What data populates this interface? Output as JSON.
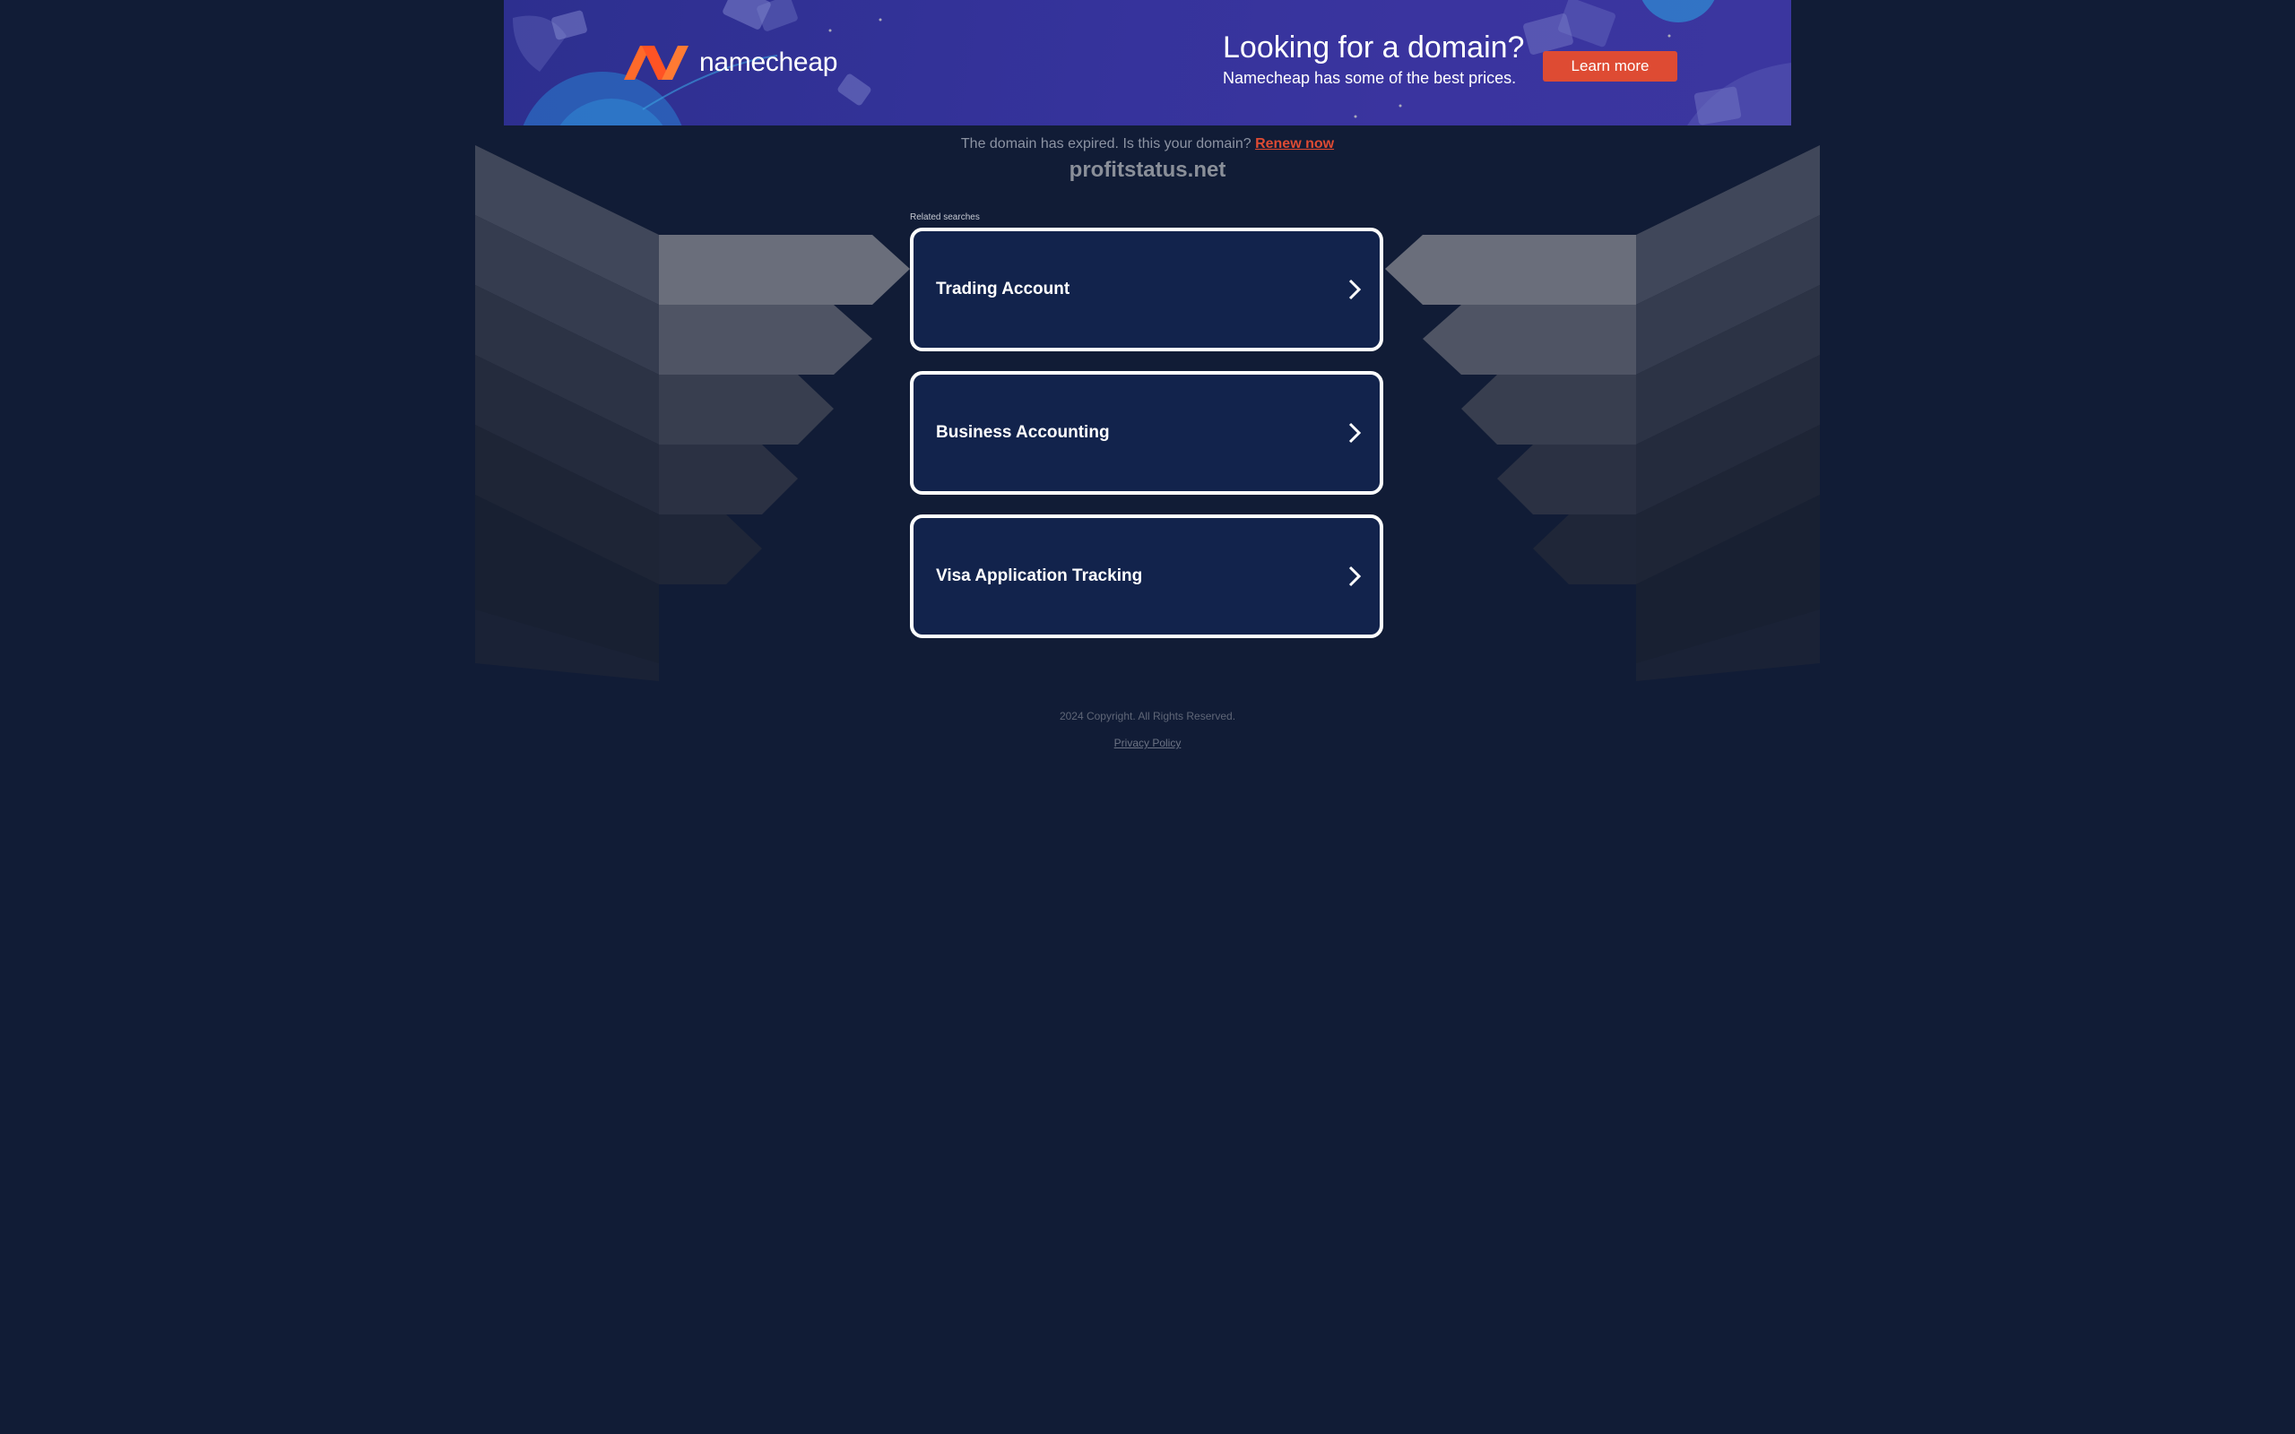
{
  "banner": {
    "brand": "namecheap",
    "title": "Looking for a domain?",
    "subtitle": "Namecheap has some of the best prices.",
    "cta_label": "Learn more",
    "brand_color": "#ff5f2a",
    "cta_color": "#de4b33"
  },
  "notice": {
    "text": "The domain has expired. Is this your domain?",
    "renew_label": "Renew now"
  },
  "domain": "profitstatus.net",
  "related": {
    "label": "Related searches",
    "items": [
      {
        "label": "Trading Account"
      },
      {
        "label": "Business Accounting"
      },
      {
        "label": "Visa Application Tracking"
      }
    ]
  },
  "footer": {
    "copyright": "2024 Copyright. All Rights Reserved.",
    "privacy_label": "Privacy Policy"
  },
  "icons": {
    "card_arrow": "chevron-right-icon",
    "logo": "namecheap-logo"
  }
}
